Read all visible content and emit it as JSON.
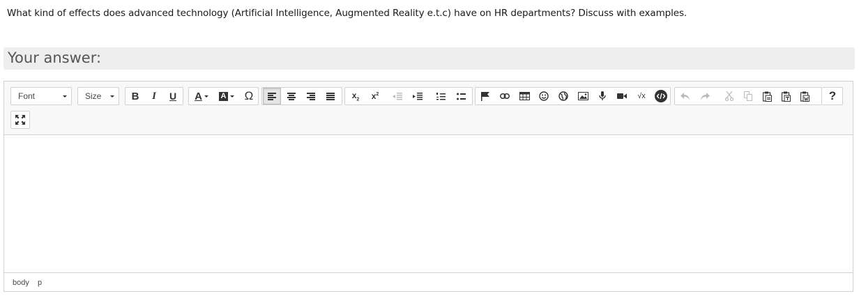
{
  "question": {
    "text": "What kind of effects does advanced technology (Artificial Intelligence, Augmented Reality e.t.c) have on HR departments? Discuss with examples."
  },
  "answer": {
    "label": "Your answer:"
  },
  "toolbar": {
    "font_label": "Font",
    "size_label": "Size",
    "bold": "B",
    "italic": "I",
    "underline": "U",
    "text_color": "A",
    "bg_color": "A",
    "special_char": "Ω",
    "subscript": "x",
    "superscript": "x",
    "help": "?"
  },
  "editor": {
    "body_text": ""
  },
  "statusbar": {
    "path": [
      "body",
      "p"
    ]
  },
  "colors": {
    "answer_bar": "#eeeeee",
    "toolbar_bg": "#f8f8f8",
    "border": "#d1d1d1",
    "active_button_bg": "#e5e5e5",
    "disabled_icon": "#b6b6b6"
  },
  "icons": [
    "bold",
    "italic",
    "underline",
    "text-color-icon",
    "background-color-icon",
    "omega-icon",
    "align-left-icon",
    "align-center-icon",
    "align-right-icon",
    "align-justify-icon",
    "subscript-icon",
    "superscript-icon",
    "outdent-icon",
    "indent-icon",
    "ordered-list-icon",
    "bullet-list-icon",
    "flag-icon",
    "link-icon",
    "table-icon",
    "smiley-icon",
    "globe-icon",
    "image-icon",
    "microphone-icon",
    "video-icon",
    "sqrt-icon",
    "source-code-icon",
    "undo-icon",
    "redo-icon",
    "cut-icon",
    "copy-icon",
    "paste-icon",
    "paste-text-icon",
    "paste-word-icon",
    "help-icon",
    "maximize-icon"
  ]
}
